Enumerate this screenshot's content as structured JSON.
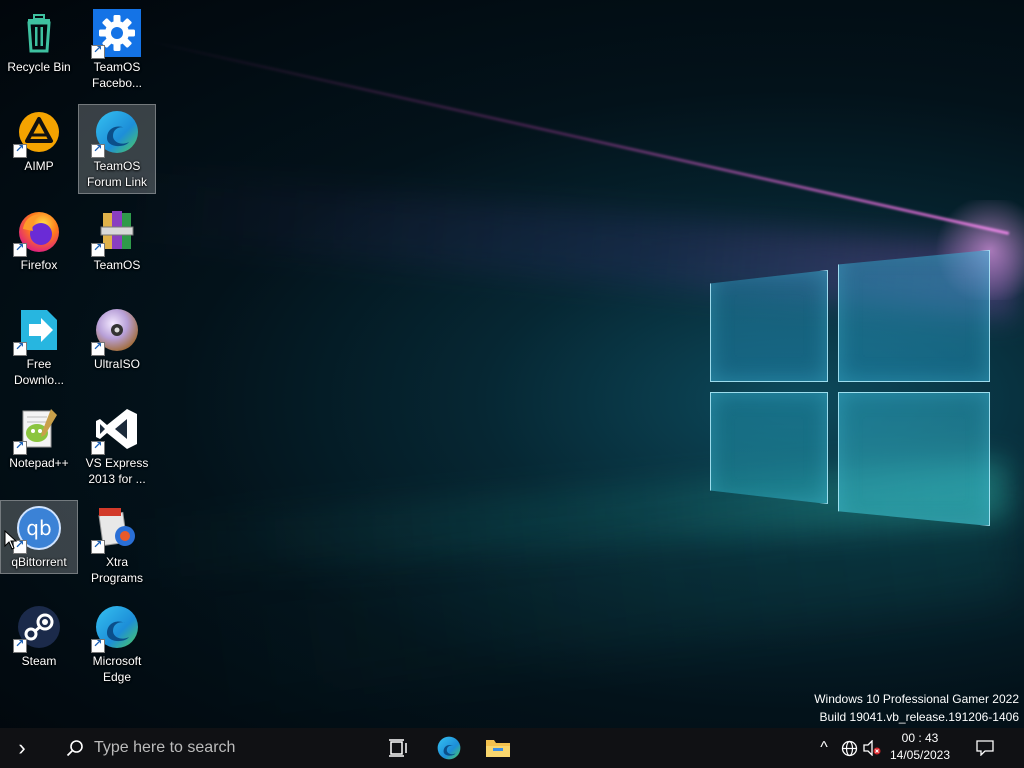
{
  "desktop": {
    "icons": [
      {
        "label": "Recycle Bin",
        "icon": "recycle-bin-icon"
      },
      {
        "label": "TeamOS Facebo...",
        "icon": "gear-icon"
      },
      {
        "label": "AIMP",
        "icon": "aimp-icon"
      },
      {
        "label": "TeamOS Forum Link",
        "icon": "edge-icon"
      },
      {
        "label": "Firefox",
        "icon": "firefox-icon"
      },
      {
        "label": "TeamOS",
        "icon": "winrar-icon"
      },
      {
        "label": "Free Downlo...",
        "icon": "free-download-manager-icon"
      },
      {
        "label": "UltraISO",
        "icon": "disc-icon"
      },
      {
        "label": "Notepad++",
        "icon": "notepad-plus-plus-icon"
      },
      {
        "label": "VS Express 2013 for ...",
        "icon": "visual-studio-icon"
      },
      {
        "label": "qBittorrent",
        "icon": "qbittorrent-icon"
      },
      {
        "label": "Xtra Programs",
        "icon": "xtra-programs-icon"
      },
      {
        "label": "Steam",
        "icon": "steam-icon"
      },
      {
        "label": "Microsoft Edge",
        "icon": "edge-icon"
      }
    ],
    "qb_glyph": "qb"
  },
  "watermark": {
    "line1": "Windows 10 Professional Gamer 2022",
    "line2": "Build 19041.vb_release.191206-1406"
  },
  "taskbar": {
    "expand_glyph": "›",
    "search_placeholder": "Type here to search",
    "tray_chevron": "^",
    "time": "00 : 43",
    "date": "14/05/2023"
  },
  "colors": {
    "taskbar_bg": "#101114",
    "accent_blue": "#1473e6",
    "selection": "#ffffff"
  }
}
